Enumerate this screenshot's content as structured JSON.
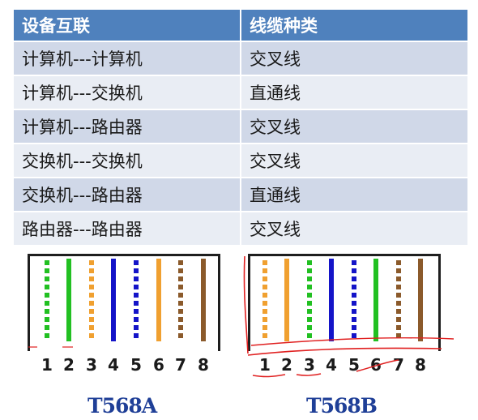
{
  "table": {
    "headers": [
      "设备互联",
      "线缆种类"
    ],
    "rows": [
      [
        "计算机---计算机",
        "交叉线"
      ],
      [
        "计算机---交换机",
        "直通线"
      ],
      [
        "计算机---路由器",
        "交叉线"
      ],
      [
        "交换机---交换机",
        "交叉线"
      ],
      [
        "交换机---路由器",
        "直通线"
      ],
      [
        "路由器---路由器",
        "交叉线"
      ]
    ]
  },
  "standards": [
    {
      "name": "T568A",
      "pins": [
        "1",
        "2",
        "3",
        "4",
        "5",
        "6",
        "7",
        "8"
      ],
      "wires": [
        {
          "color": "#22c022",
          "striped": true
        },
        {
          "color": "#22c022",
          "striped": false
        },
        {
          "color": "#f0a030",
          "striped": true
        },
        {
          "color": "#1414c8",
          "striped": false
        },
        {
          "color": "#1414c8",
          "striped": true
        },
        {
          "color": "#f0a030",
          "striped": false
        },
        {
          "color": "#8b5a2b",
          "striped": true
        },
        {
          "color": "#8b5a2b",
          "striped": false
        }
      ]
    },
    {
      "name": "T568B",
      "pins": [
        "1",
        "2",
        "3",
        "4",
        "5",
        "6",
        "7",
        "8"
      ],
      "wires": [
        {
          "color": "#f0a030",
          "striped": true
        },
        {
          "color": "#f0a030",
          "striped": false
        },
        {
          "color": "#22c022",
          "striped": true
        },
        {
          "color": "#1414c8",
          "striped": false
        },
        {
          "color": "#1414c8",
          "striped": true
        },
        {
          "color": "#22c022",
          "striped": false
        },
        {
          "color": "#8b5a2b",
          "striped": true
        },
        {
          "color": "#8b5a2b",
          "striped": false
        }
      ]
    }
  ],
  "colors": {
    "header_bg": "#4f81bd",
    "row_odd": "#d0d8e8",
    "row_even": "#e9edf4",
    "label": "#1f3f97",
    "annotation": "#e02020"
  }
}
